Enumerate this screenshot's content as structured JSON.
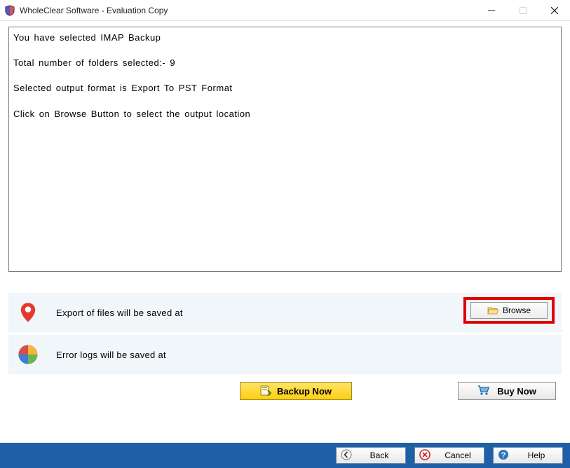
{
  "window": {
    "title": "WholeClear Software - Evaluation Copy"
  },
  "summary": {
    "line1": "You have selected IMAP Backup",
    "line2": "Total number of folders selected:- 9",
    "line3": "Selected output format is Export To PST Format",
    "line4": "Click on Browse Button to select the output location"
  },
  "rows": {
    "export_label": "Export of files will be saved at",
    "errorlog_label": "Error logs will be saved at",
    "browse_label": "Browse"
  },
  "actions": {
    "backup_label": "Backup Now",
    "buy_label": "Buy Now"
  },
  "footer": {
    "back_label": "Back",
    "cancel_label": "Cancel",
    "help_label": "Help"
  }
}
